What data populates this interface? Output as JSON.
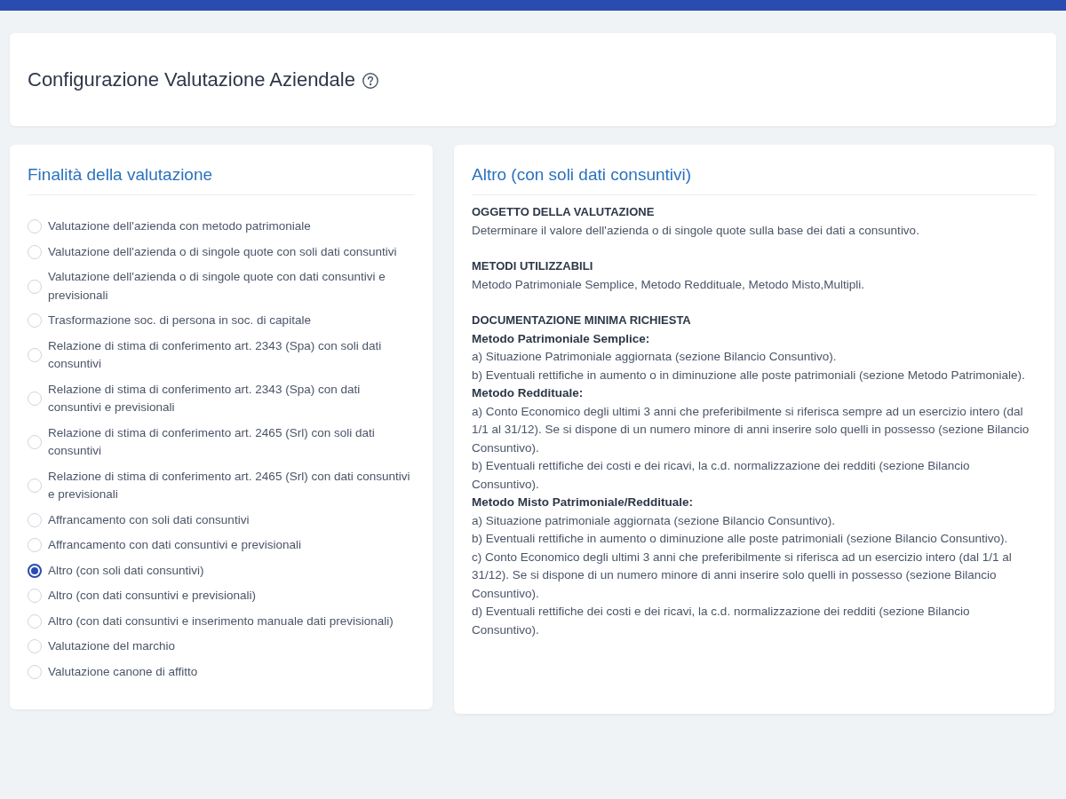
{
  "page": {
    "title": "Configurazione Valutazione Aziendale"
  },
  "purpose_panel": {
    "title": "Finalità della valutazione",
    "options": [
      {
        "label": "Valutazione dell'azienda con metodo patrimoniale",
        "selected": false
      },
      {
        "label": "Valutazione dell'azienda o di singole quote con soli dati consuntivi",
        "selected": false
      },
      {
        "label": "Valutazione dell'azienda o di singole quote con dati consuntivi e previsionali",
        "selected": false
      },
      {
        "label": "Trasformazione soc. di persona in soc. di capitale",
        "selected": false
      },
      {
        "label": "Relazione di stima di conferimento art. 2343 (Spa) con soli dati consuntivi",
        "selected": false
      },
      {
        "label": "Relazione di stima di conferimento art. 2343 (Spa) con dati consuntivi e previsionali",
        "selected": false
      },
      {
        "label": "Relazione di stima di conferimento art. 2465 (Srl) con soli dati consuntivi",
        "selected": false
      },
      {
        "label": "Relazione di stima di conferimento art. 2465 (Srl) con dati consuntivi e previsionali",
        "selected": false
      },
      {
        "label": "Affrancamento con soli dati consuntivi",
        "selected": false
      },
      {
        "label": "Affrancamento con dati consuntivi e previsionali",
        "selected": false
      },
      {
        "label": "Altro (con soli dati consuntivi)",
        "selected": true
      },
      {
        "label": "Altro (con dati consuntivi e previsionali)",
        "selected": false
      },
      {
        "label": "Altro (con dati consuntivi e inserimento manuale dati previsionali)",
        "selected": false
      },
      {
        "label": "Valutazione del marchio",
        "selected": false
      },
      {
        "label": "Valutazione canone di affitto",
        "selected": false
      }
    ]
  },
  "detail_panel": {
    "title": "Altro (con soli dati consuntivi)",
    "sections": [
      {
        "heading": "OGGETTO DELLA VALUTAZIONE",
        "lines": [
          {
            "kind": "text",
            "text": "Determinare il valore dell'azienda o di singole quote sulla base dei dati a consuntivo."
          }
        ]
      },
      {
        "heading": "METODI UTILIZZABILI",
        "lines": [
          {
            "kind": "text",
            "text": "Metodo Patrimoniale Semplice, Metodo Reddituale, Metodo Misto,Multipli."
          }
        ]
      },
      {
        "heading": "DOCUMENTAZIONE MINIMA RICHIESTA",
        "lines": [
          {
            "kind": "subheading",
            "text": "Metodo Patrimoniale Semplice:"
          },
          {
            "kind": "text",
            "text": "a) Situazione Patrimoniale aggiornata (sezione Bilancio Consuntivo)."
          },
          {
            "kind": "text",
            "text": "b) Eventuali rettifiche in aumento o in diminuzione alle poste patrimoniali (sezione Metodo Patrimoniale)."
          },
          {
            "kind": "subheading",
            "text": "Metodo Reddituale:"
          },
          {
            "kind": "text",
            "text": "a) Conto Economico degli ultimi 3 anni che preferibilmente si riferisca sempre ad un esercizio intero (dal 1/1 al 31/12). Se si dispone di un numero minore di anni inserire solo quelli in possesso (sezione Bilancio Consuntivo)."
          },
          {
            "kind": "text",
            "text": "b) Eventuali rettifiche dei costi e dei ricavi, la c.d. normalizzazione dei redditi (sezione Bilancio Consuntivo)."
          },
          {
            "kind": "subheading",
            "text": "Metodo Misto Patrimoniale/Reddituale:"
          },
          {
            "kind": "text",
            "text": "a) Situazione patrimoniale aggiornata (sezione Bilancio Consuntivo)."
          },
          {
            "kind": "text",
            "text": "b) Eventuali rettifiche in aumento o diminuzione alle poste patrimoniali (sezione Bilancio Consuntivo)."
          },
          {
            "kind": "text",
            "text": "c) Conto Economico degli ultimi 3 anni che preferibilmente si riferisca ad un esercizio intero (dal 1/1 al 31/12). Se si dispone di un numero minore di anni inserire solo quelli in possesso (sezione Bilancio Consuntivo)."
          },
          {
            "kind": "text",
            "text": "d) Eventuali rettifiche dei costi e dei ricavi, la c.d. normalizzazione dei redditi (sezione Bilancio Consuntivo)."
          }
        ]
      }
    ]
  }
}
